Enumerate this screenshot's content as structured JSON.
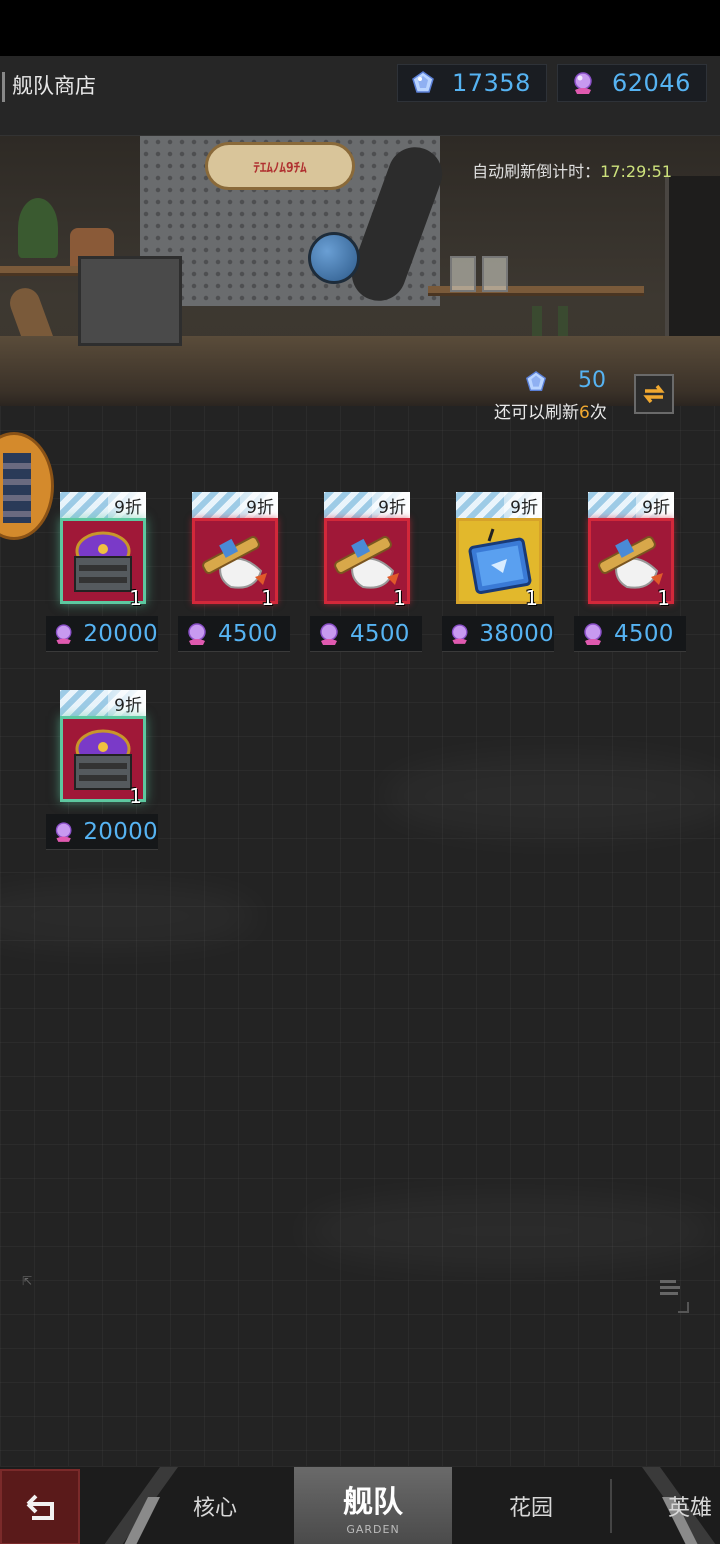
{
  "header": {
    "title": "舰队商店",
    "currencies": [
      {
        "icon": "diamond-gem-icon",
        "value": "17358"
      },
      {
        "icon": "pink-crystal-icon",
        "value": "62046"
      }
    ]
  },
  "banner": {
    "sign_text": "ﾃｴﾑﾉﾑ9ﾁﾑ",
    "refresh_timer_label": "自动刷新倒计时：",
    "refresh_timer_value": "17:29:51"
  },
  "refresh": {
    "cost": "50",
    "text_before": "还可以刷新",
    "remaining": "6",
    "text_after": "次",
    "button_icon": "refresh-arrows-icon"
  },
  "items": [
    {
      "discount": "9折",
      "type": "treasure-chest",
      "rarity": "green",
      "qty": "1",
      "price": "20000"
    },
    {
      "discount": "9折",
      "type": "rocket-cannon",
      "rarity": "red",
      "qty": "1",
      "price": "4500"
    },
    {
      "discount": "9折",
      "type": "rocket-cannon",
      "rarity": "red",
      "qty": "1",
      "price": "4500"
    },
    {
      "discount": "9折",
      "type": "blue-chip-card",
      "rarity": "gold",
      "qty": "1",
      "price": "38000"
    },
    {
      "discount": "9折",
      "type": "rocket-cannon",
      "rarity": "red",
      "qty": "1",
      "price": "4500"
    },
    {
      "discount": "9折",
      "type": "treasure-chest",
      "rarity": "green",
      "qty": "1",
      "price": "20000"
    }
  ],
  "nav": {
    "back_icon": "back-arrow-icon",
    "tabs": [
      {
        "label": "核心"
      },
      {
        "label": "舰队",
        "sub": "GARDEN",
        "active": true
      },
      {
        "label": "花园"
      },
      {
        "label": "英雄"
      }
    ]
  },
  "colors": {
    "accent_blue": "#56b3f2",
    "timer_green": "#cde27c",
    "refresh_orange": "#f0a830",
    "rarity_green": "#5dc8a0",
    "rarity_red": "#d2283a",
    "rarity_gold": "#d6a22a"
  }
}
